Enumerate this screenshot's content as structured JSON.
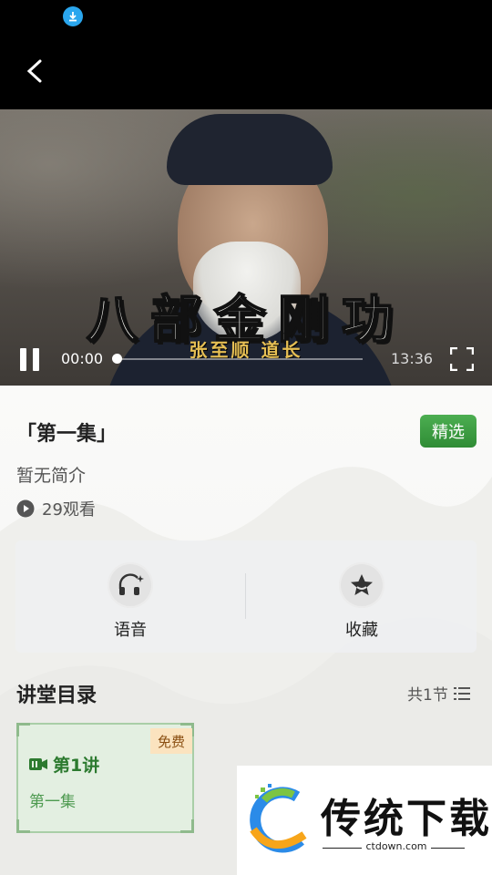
{
  "status_bar": {
    "download_icon": "download-arrow-icon"
  },
  "nav": {
    "back_icon": "chevron-left-icon"
  },
  "video": {
    "title_overlay": "八部金刚功",
    "subtitle_overlay": "张至顺  道长",
    "current_time": "00:00",
    "total_time": "13:36",
    "progress": 0
  },
  "episode": {
    "title": "「第一集」",
    "tag": "精选",
    "description": "暂无简介",
    "views": "29观看"
  },
  "actions": [
    {
      "label": "语音",
      "icon": "headphones-icon"
    },
    {
      "label": "收藏",
      "icon": "star-icon"
    }
  ],
  "catalog": {
    "title": "讲堂目录",
    "count": "共1节",
    "lessons": [
      {
        "badge": "免费",
        "name": "第1讲",
        "subtitle": "第一集"
      }
    ]
  },
  "watermark": {
    "brand": "传统下载",
    "url": "ctdown.com"
  },
  "colors": {
    "accent_green": "#3d9c42",
    "badge_orange_bg": "#fbe3bf",
    "status_blue": "#2aa6ee"
  }
}
